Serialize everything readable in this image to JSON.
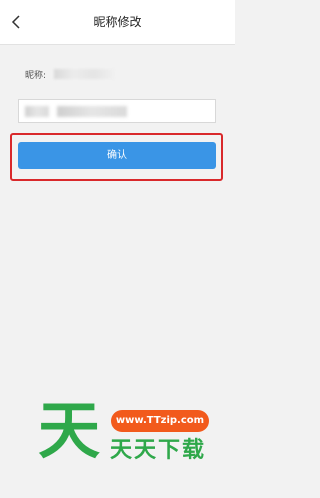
{
  "header": {
    "title": "昵称修改"
  },
  "form": {
    "nickname_label": "昵称:",
    "confirm_label": "确认"
  },
  "colors": {
    "accent": "#3a95e6",
    "highlight": "#d9292b",
    "watermark_green": "#2fa84a",
    "watermark_orange": "#f25a1c"
  },
  "icons": {
    "back": "chevron-left-icon"
  },
  "watermark": {
    "logo_char": "天",
    "url": "www.TTzip.com",
    "brand": "天天下载"
  }
}
